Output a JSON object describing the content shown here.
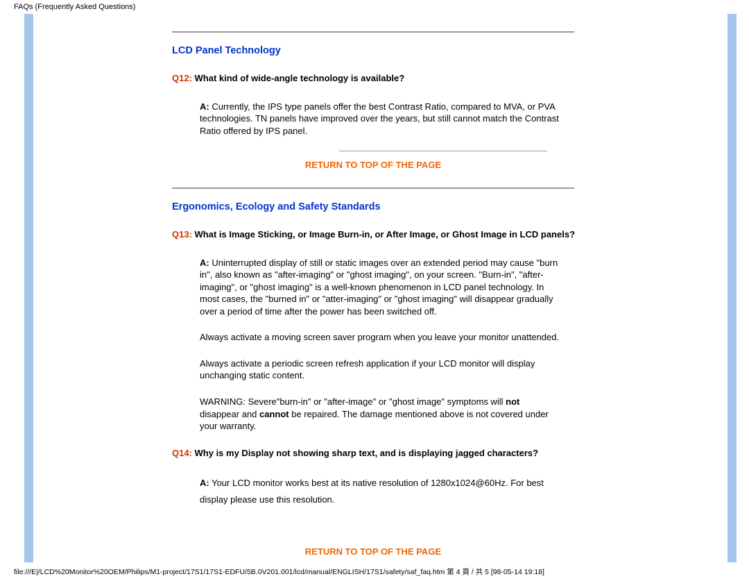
{
  "header": "FAQs (Frequently Asked Questions)",
  "section1": {
    "title": "LCD Panel Technology",
    "q12_num": "Q12:",
    "q12_text": " What kind of wide-angle technology is available?",
    "q12_a_letter": "A:",
    "q12_answer": " Currently, the IPS type panels offer the best Contrast Ratio, compared to MVA, or PVA technologies.  TN panels have improved over the years, but still cannot match the Contrast Ratio offered by IPS panel.",
    "return1": "RETURN TO TOP OF THE PAGE"
  },
  "section2": {
    "title": "Ergonomics, Ecology and Safety Standards",
    "q13_num": "Q13:",
    "q13_text": " What is Image Sticking, or Image Burn-in, or After Image, or Ghost Image in LCD panels?",
    "q13_a_letter": "A:",
    "q13_p1": " Uninterrupted display of still or static images over an extended period may cause \"burn in\", also known as \"after-imaging\" or \"ghost imaging\", on your screen. \"Burn-in\", \"after-imaging\", or \"ghost imaging\" is a well-known phenomenon in LCD panel technology. In most cases, the \"burned in\" or \"atter-imaging\" or \"ghost imaging\" will disappear gradually over a period of time after the power has been switched off.",
    "q13_p2": "Always activate a moving screen saver program when you leave your monitor unattended.",
    "q13_p3": "Always activate a periodic screen refresh application if your LCD monitor will display unchanging static content.",
    "q13_warn_pre": "WARNING: Severe\"burn-in\" or \"after-image\" or \"ghost image\" symptoms will ",
    "q13_not": "not",
    "q13_warn_mid": " disappear and ",
    "q13_cannot": "cannot",
    "q13_warn_post": " be repaired. The damage mentioned above is not covered under your warranty.",
    "q14_num": "Q14:",
    "q14_text": " Why is my Display not showing sharp text, and is displaying jagged characters?",
    "q14_a_letter": "A:",
    "q14_answer": " Your LCD monitor works best at its native resolution of 1280x1024@60Hz. For best display please use this resolution.",
    "return2": "RETURN TO TOP OF THE PAGE"
  },
  "footer": "file:///E|/LCD%20Monitor%20OEM/Philips/M1-project/17S1/17S1-EDFU/5B.0V201.001/lcd/manual/ENGLISH/17S1/safety/saf_faq.htm 第 4 頁 / 共 5  [98-05-14 19:18]"
}
